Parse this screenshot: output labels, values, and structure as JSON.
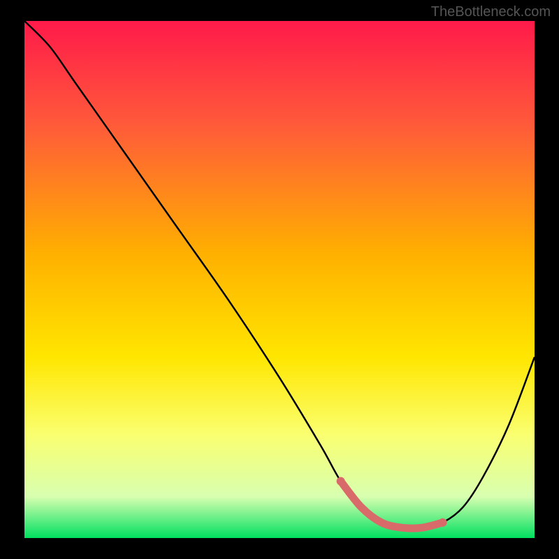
{
  "watermark": "TheBottleneck.com",
  "chart_data": {
    "type": "line",
    "title": "",
    "xlabel": "",
    "ylabel": "",
    "xlim": [
      0,
      100
    ],
    "ylim": [
      0,
      100
    ],
    "gradient_stops": [
      {
        "offset": 0,
        "color": "#ff1a4a"
      },
      {
        "offset": 20,
        "color": "#ff5a3a"
      },
      {
        "offset": 45,
        "color": "#ffb000"
      },
      {
        "offset": 65,
        "color": "#ffe600"
      },
      {
        "offset": 80,
        "color": "#faff70"
      },
      {
        "offset": 92,
        "color": "#d8ffb0"
      },
      {
        "offset": 100,
        "color": "#00e060"
      }
    ],
    "series": [
      {
        "name": "bottleneck-curve",
        "x": [
          0,
          5,
          10,
          20,
          30,
          40,
          50,
          58,
          62,
          66,
          70,
          74,
          78,
          82,
          86,
          90,
          95,
          100
        ],
        "y": [
          100,
          95,
          88,
          74,
          60,
          46,
          31,
          18,
          11,
          6,
          3,
          2,
          2,
          3,
          6,
          12,
          22,
          35
        ]
      }
    ],
    "highlight_segment": {
      "name": "optimal-range",
      "x": [
        62,
        66,
        70,
        74,
        78,
        82
      ],
      "y": [
        11,
        6,
        3,
        2,
        2,
        3
      ]
    }
  }
}
